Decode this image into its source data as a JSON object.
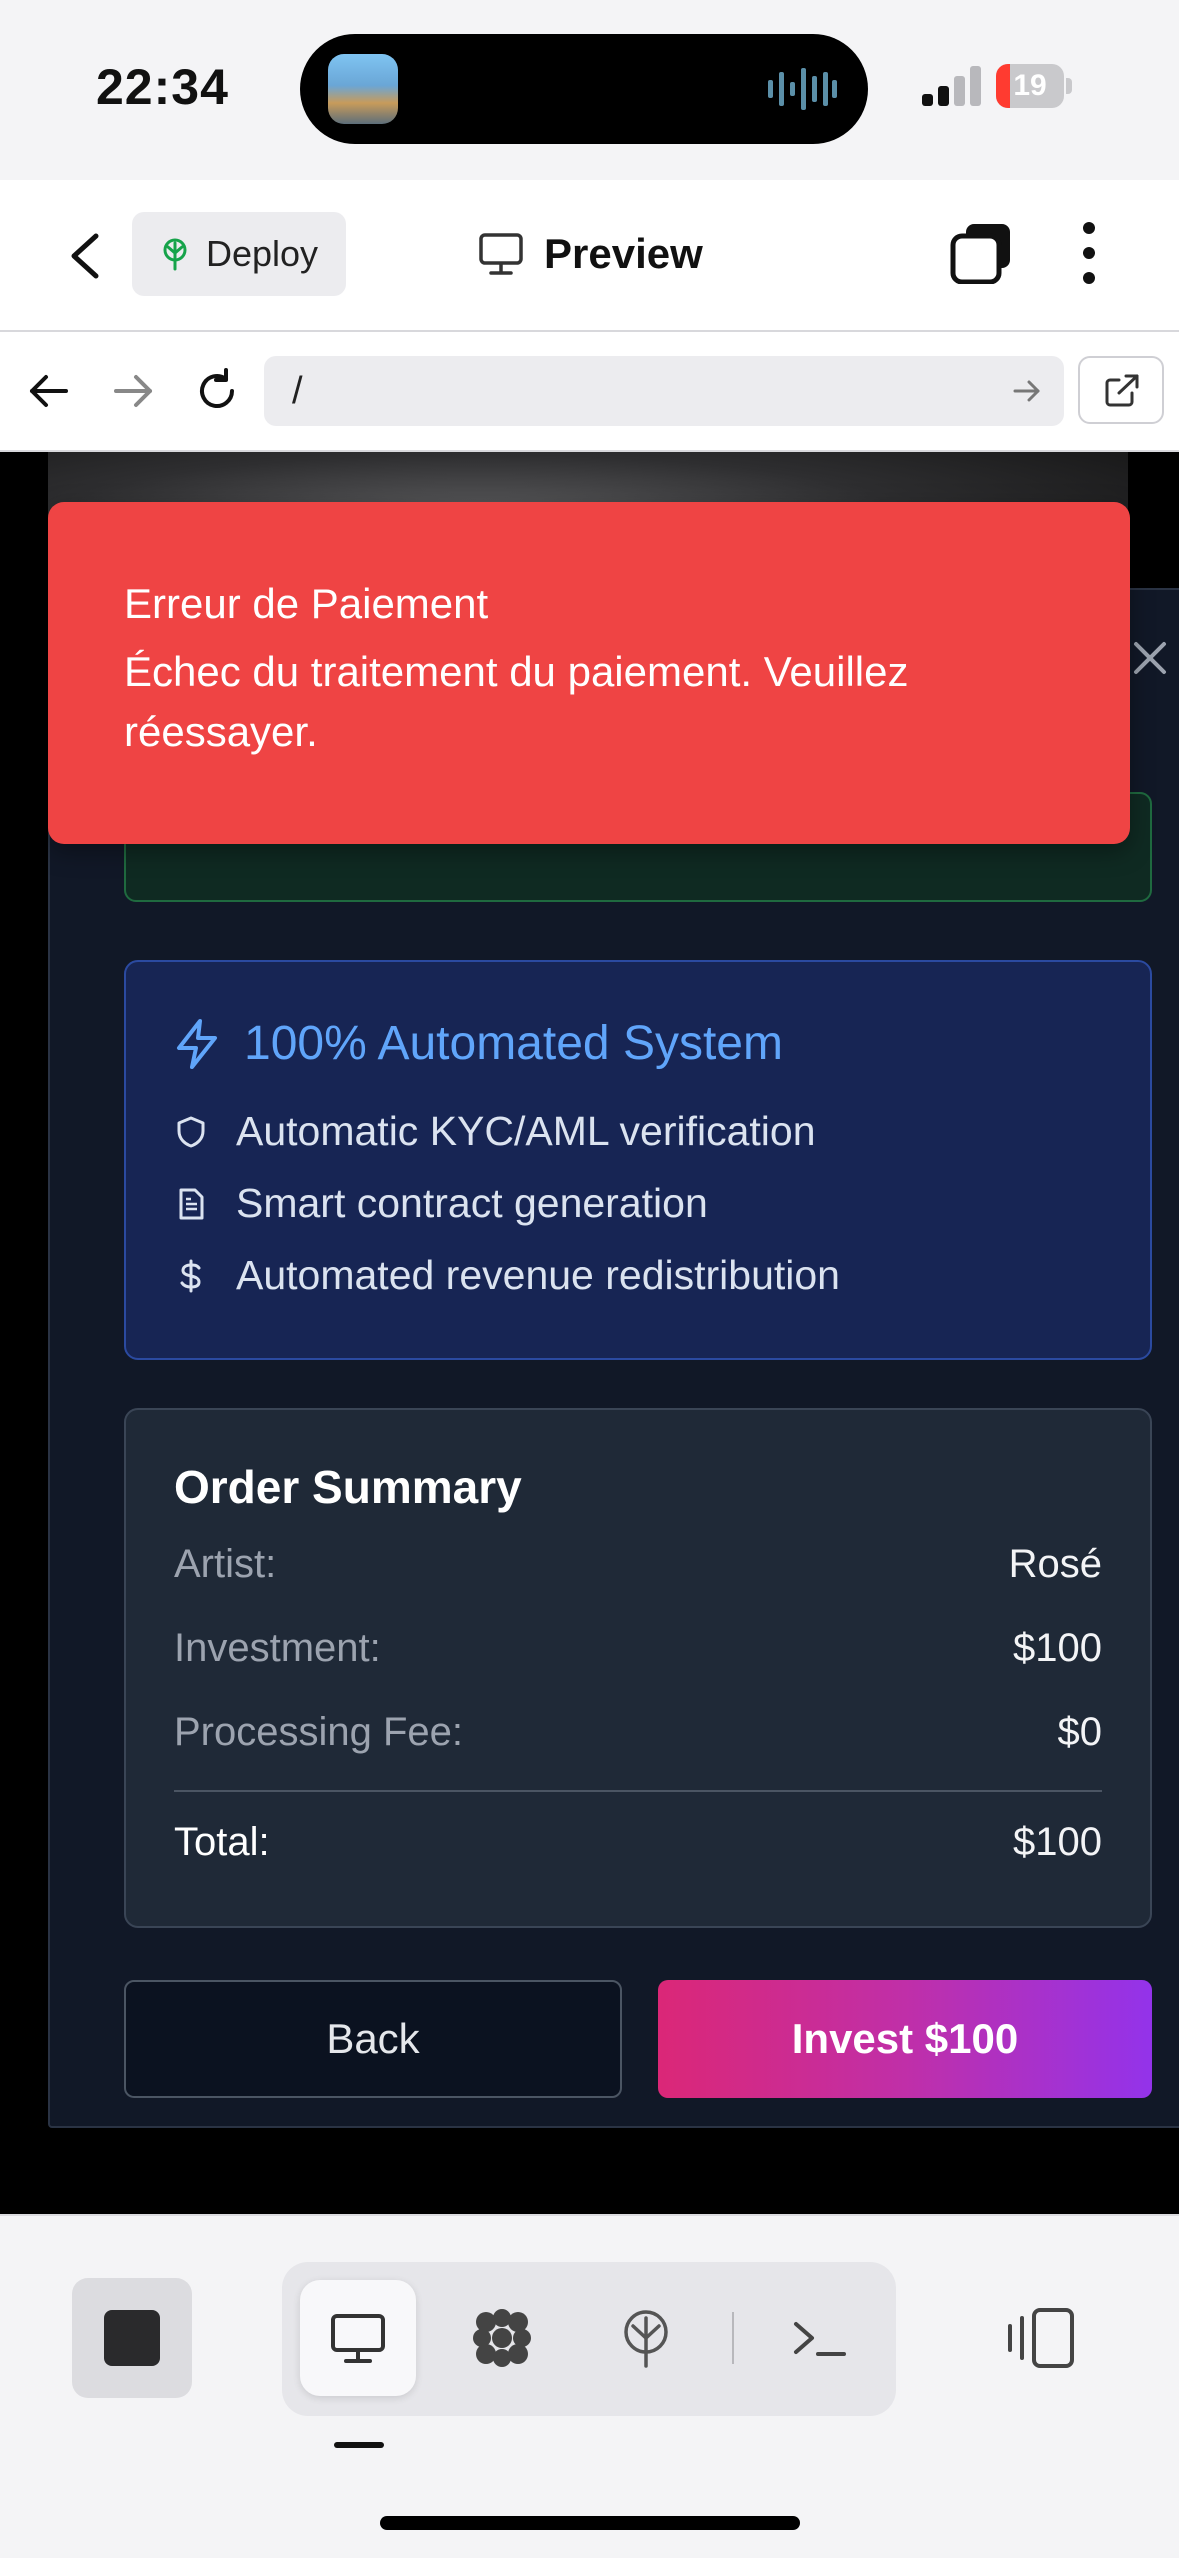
{
  "status_bar": {
    "time": "22:34",
    "battery": "19"
  },
  "header": {
    "deploy_label": "Deploy",
    "preview_label": "Preview"
  },
  "url_bar": {
    "url": "/"
  },
  "toast": {
    "title": "Erreur de Paiement",
    "message": "Échec du traitement du paiement. Veuillez réessayer."
  },
  "automation": {
    "title": "100% Automated System",
    "features": [
      {
        "icon": "shield-icon",
        "label": "Automatic KYC/AML verification"
      },
      {
        "icon": "document-icon",
        "label": "Smart contract generation"
      },
      {
        "icon": "dollar-icon",
        "label": "Automated revenue redistribution"
      }
    ]
  },
  "summary": {
    "title": "Order Summary",
    "rows": [
      {
        "label": "Artist:",
        "value": "Rosé"
      },
      {
        "label": "Investment:",
        "value": "$100"
      },
      {
        "label": "Processing Fee:",
        "value": "$0"
      }
    ],
    "total": {
      "label": "Total:",
      "value": "$100"
    }
  },
  "buttons": {
    "back": "Back",
    "invest": "Invest $100"
  },
  "colors": {
    "toast_bg": "#ef4444",
    "accent_blue": "#60a5fa",
    "invest_gradient_start": "#db2777",
    "invest_gradient_end": "#9333ea",
    "modal_bg": "#111827"
  }
}
